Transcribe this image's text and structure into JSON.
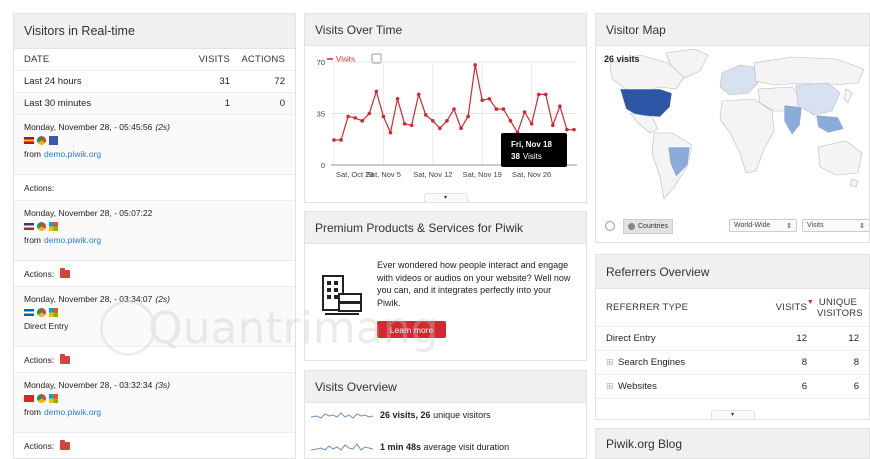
{
  "realtime": {
    "title": "Visitors in Real-time",
    "headers": {
      "date": "DATE",
      "visits": "VISITS",
      "actions": "ACTIONS"
    },
    "rows": [
      {
        "label": "Last 24 hours",
        "visits": "31",
        "actions": "72"
      },
      {
        "label": "Last 30 minutes",
        "visits": "1",
        "actions": "0"
      }
    ],
    "visits": [
      {
        "time": "Monday, November 28, - 05:45:56",
        "dur": "(2s)",
        "from_label": "from",
        "source": "demo.piwik.org",
        "actions_label": "Actions:",
        "flag": "es",
        "has_folder": false
      },
      {
        "time": "Monday, November 28, - 05:07:22",
        "dur": "",
        "from_label": "from",
        "source": "demo.piwik.org",
        "actions_label": "Actions:",
        "flag": "us",
        "has_folder": true
      },
      {
        "time": "Monday, November 28, - 03:34:07",
        "dur": "(2s)",
        "from_label": "",
        "source": "Direct Entry",
        "actions_label": "Actions:",
        "flag": "gr",
        "has_folder": true
      },
      {
        "time": "Monday, November 28, - 03:32:34",
        "dur": "(3s)",
        "from_label": "from",
        "source": "demo.piwik.org",
        "actions_label": "Actions:",
        "flag": "cn",
        "has_folder": true
      }
    ]
  },
  "visits_over_time": {
    "title": "Visits Over Time",
    "legend": "Visits",
    "tooltip": {
      "date": "Fri, Nov 18",
      "value": "38",
      "label": "Visits"
    }
  },
  "chart_data": {
    "type": "line",
    "series": [
      {
        "name": "Visits",
        "values": [
          17,
          17,
          33,
          32,
          30,
          35,
          50,
          33,
          22,
          45,
          28,
          27,
          48,
          34,
          30,
          25,
          30,
          38,
          25,
          33,
          68,
          44,
          45,
          38,
          38,
          30,
          22,
          36,
          28,
          48,
          48,
          27,
          40,
          24,
          24
        ]
      }
    ],
    "x_ticks": [
      "Sat, Oct 29",
      "Sat, Nov 5",
      "Sat, Nov 12",
      "Sat, Nov 19",
      "Sat, Nov 26"
    ],
    "y_ticks": [
      "70",
      "35",
      "0"
    ],
    "ylim": [
      0,
      70
    ],
    "color": "#d4272e"
  },
  "premium": {
    "title": "Premium Products & Services for Piwik",
    "text": "Ever wondered how people interact and engage with videos or audios on your website? Well now you can, and it integrates perfectly into your Piwik.",
    "button": "Learn more"
  },
  "visits_overview": {
    "title": "Visits Overview",
    "items": [
      {
        "value": "26 visits, 26",
        "rest": "unique visitors"
      },
      {
        "value": "1 min 48s",
        "rest": "average visit duration"
      }
    ]
  },
  "map": {
    "title": "Visitor Map",
    "count_label": "26 visits",
    "countries_button": "Countries",
    "region_select": "World-Wide",
    "metric_select": "Visits",
    "colors": {
      "high": "#2e56a6",
      "mid": "#8cabd8",
      "low": "#d8e1ef",
      "none": "#f4f4f4"
    }
  },
  "referrers": {
    "title": "Referrers Overview",
    "headers": {
      "type": "REFERRER TYPE",
      "visits": "VISITS",
      "unique": "UNIQUE VISITORS"
    },
    "rows": [
      {
        "label": "Direct Entry",
        "visits": "12",
        "unique": "12"
      },
      {
        "label": "Search Engines",
        "visits": "8",
        "unique": "8"
      },
      {
        "label": "Websites",
        "visits": "6",
        "unique": "6"
      }
    ]
  },
  "blog": {
    "title": "Piwik.org Blog"
  },
  "watermark": "Quantrimang"
}
